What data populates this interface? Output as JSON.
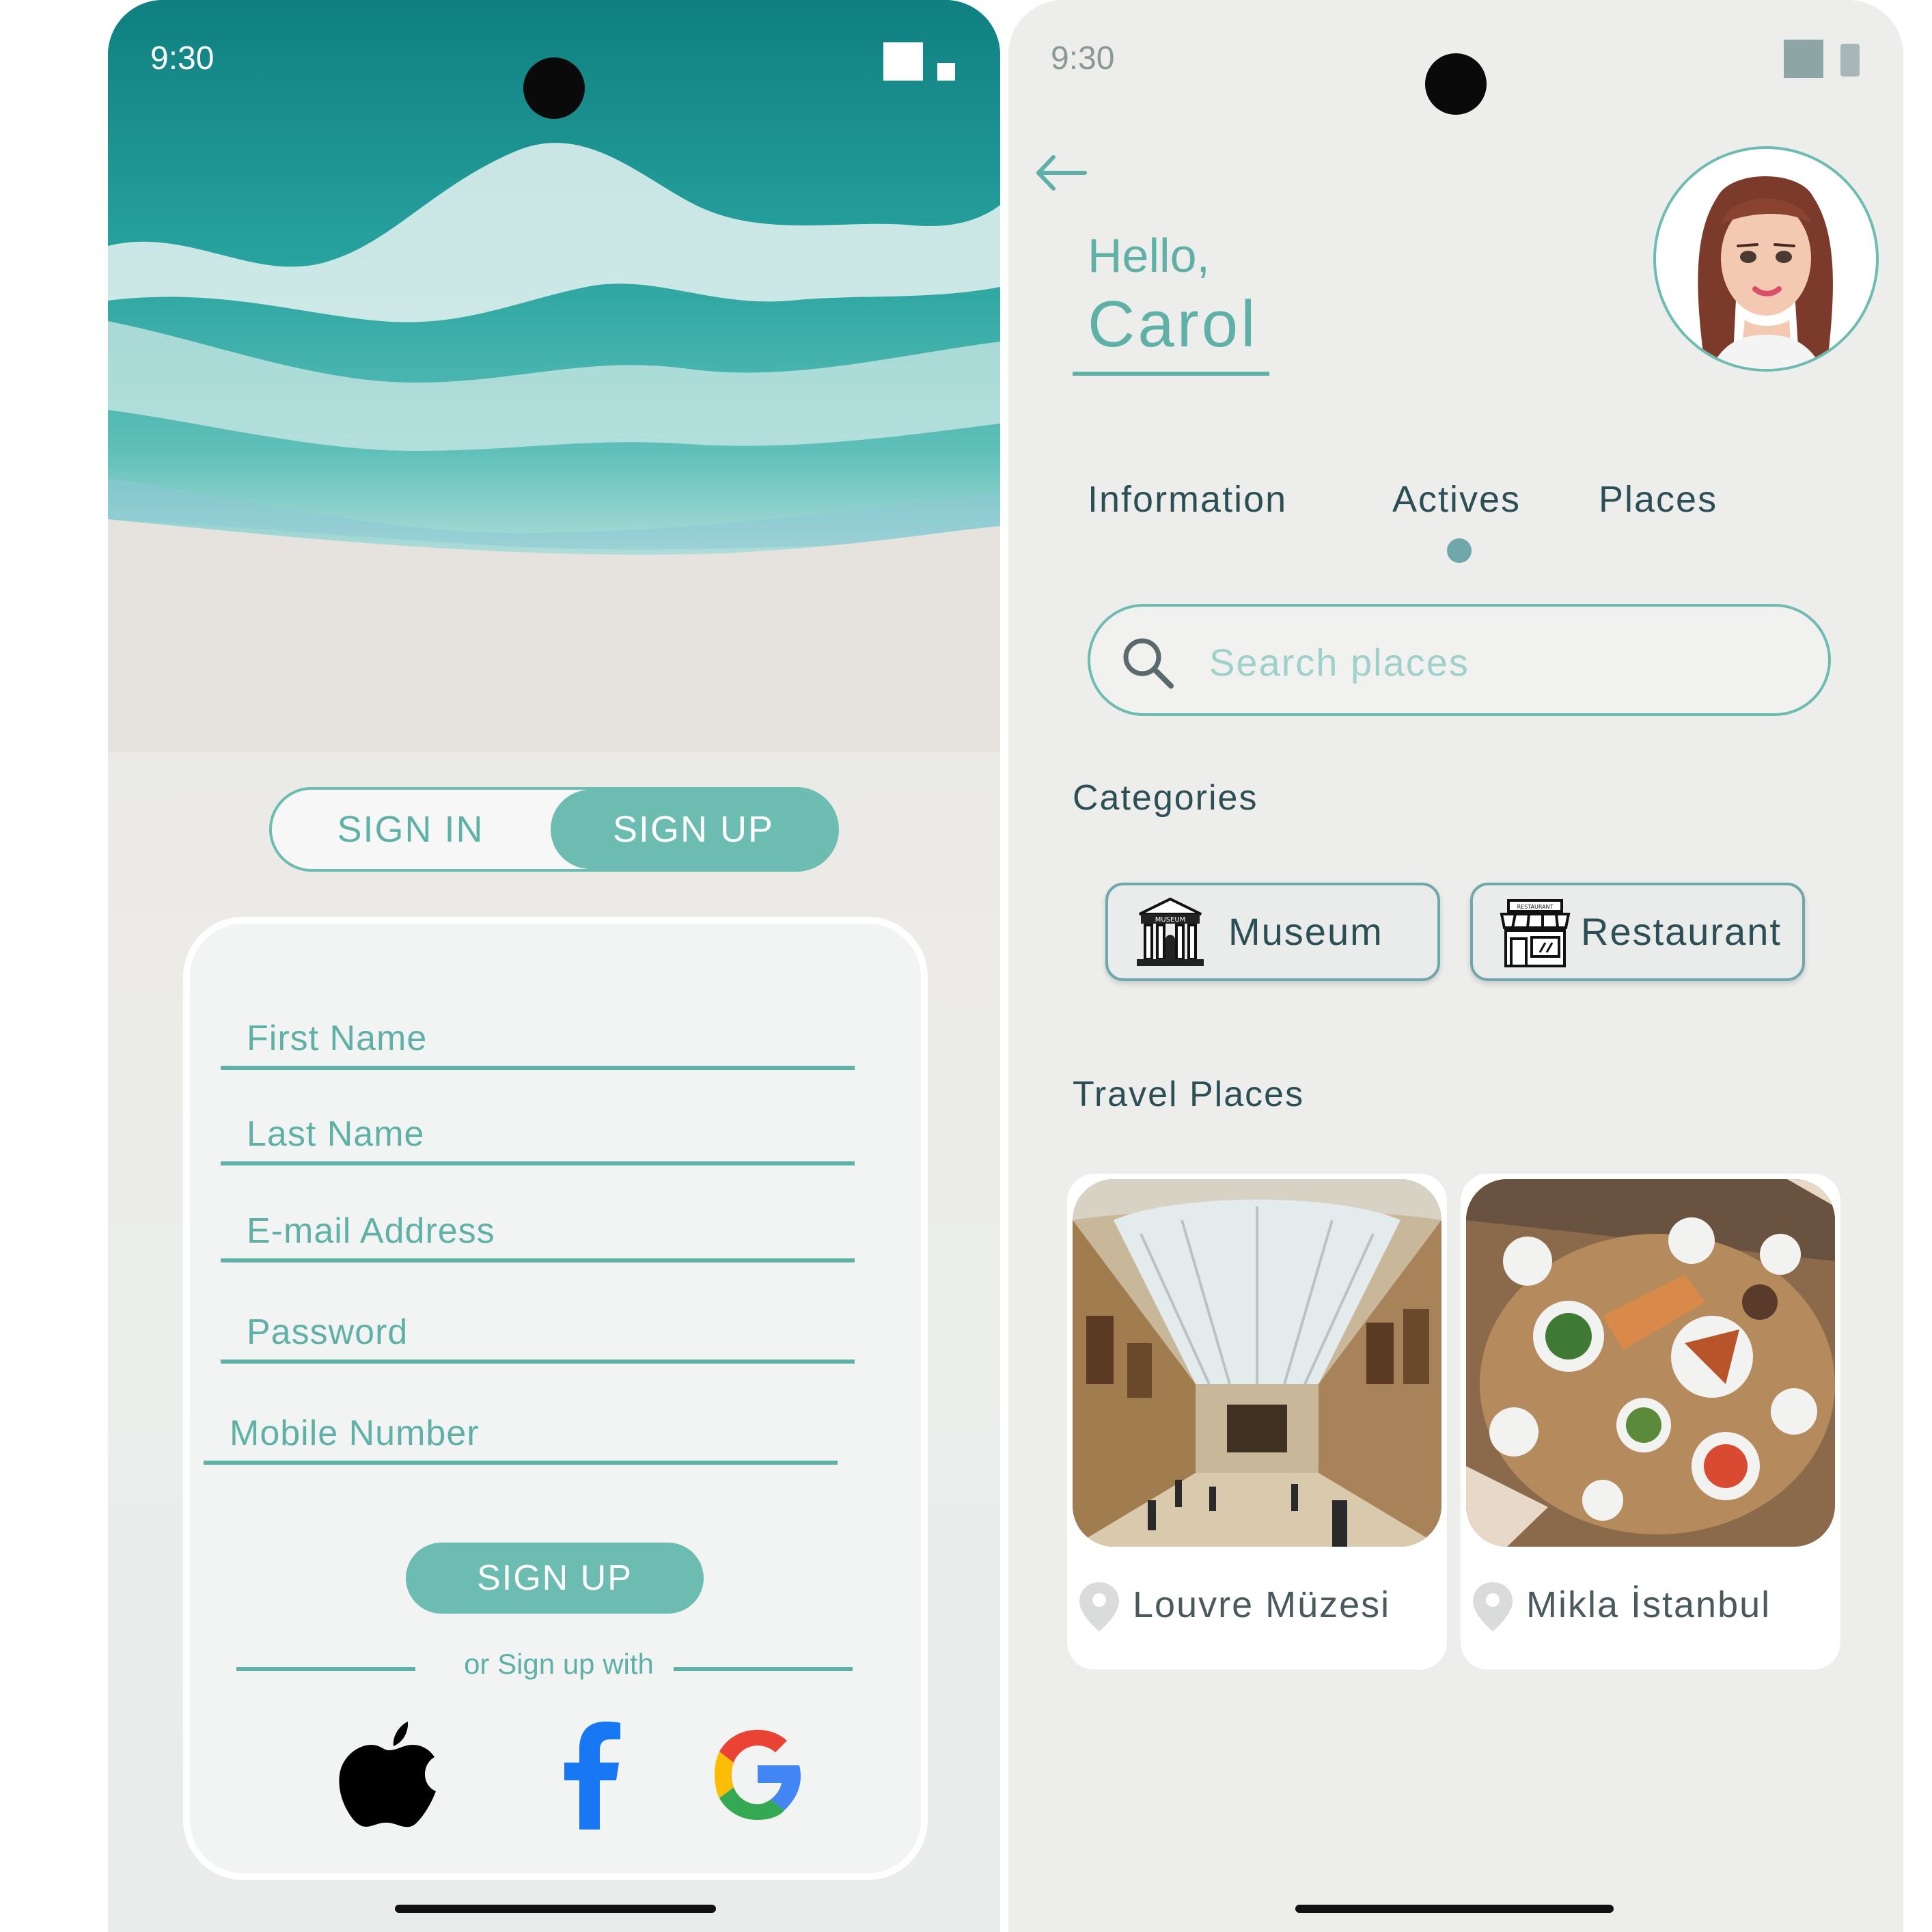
{
  "left_phone": {
    "status_time": "9:30",
    "auth_toggle": {
      "sign_in_label": "SIGN IN",
      "sign_up_label": "SIGN UP",
      "selected": "SIGN UP"
    },
    "fields": [
      {
        "placeholder": "First Name"
      },
      {
        "placeholder": "Last Name"
      },
      {
        "placeholder": "E-mail Address"
      },
      {
        "placeholder": "Password"
      },
      {
        "placeholder": "Mobile Number"
      }
    ],
    "submit_label": "SIGN UP",
    "divider_text": "or Sign up with",
    "social_icons": [
      "apple-icon",
      "facebook-icon",
      "google-icon"
    ],
    "accent_color": "#6dbcb2"
  },
  "right_phone": {
    "status_time": "9:30",
    "greeting": "Hello,",
    "user_name": "Carol",
    "tabs": [
      {
        "label": "Information"
      },
      {
        "label": "Actives",
        "selected": true
      },
      {
        "label": "Places"
      }
    ],
    "search": {
      "placeholder": "Search places"
    },
    "categories_title": "Categories",
    "categories": [
      {
        "label": "Museum",
        "icon": "museum-icon",
        "icon_text": "MUSEUM"
      },
      {
        "label": "Restaurant",
        "icon": "restaurant-icon",
        "icon_text": "RESTAURANT"
      }
    ],
    "travel_title": "Travel Places",
    "places": [
      {
        "name": "Louvre Müzesi",
        "image": "museum-gallery-photo"
      },
      {
        "name": "Mikla  İstanbul",
        "image": "food-table-photo"
      }
    ],
    "accent_color": "#6dbcb2",
    "text_color": "#2c4e55"
  }
}
